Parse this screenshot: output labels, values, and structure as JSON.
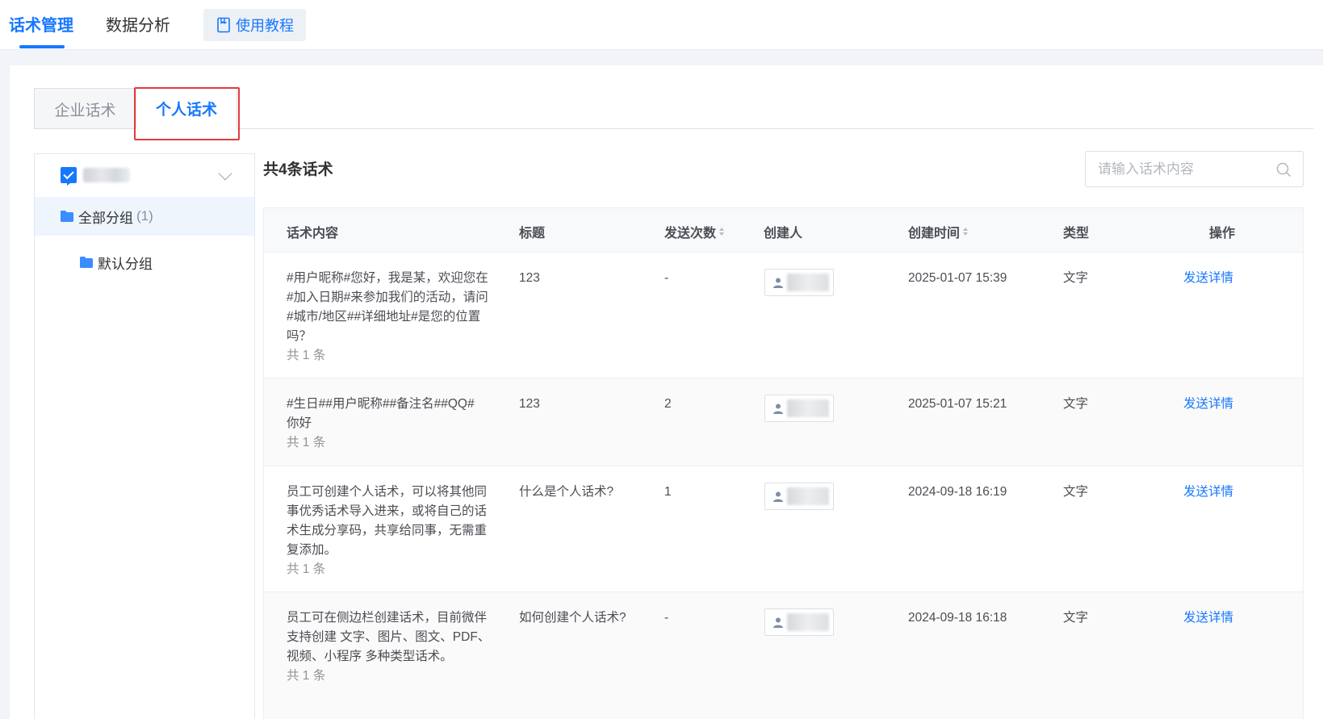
{
  "top_nav": {
    "tabs": [
      {
        "label": "话术管理",
        "active": true
      },
      {
        "label": "数据分析",
        "active": false
      }
    ],
    "tutorial_label": "使用教程"
  },
  "sub_tabs": {
    "enterprise": "企业话术",
    "personal": "个人话术"
  },
  "group_panel": {
    "all_group_label": "全部分组",
    "all_group_count": "(1)",
    "default_group_label": "默认分组"
  },
  "content": {
    "count_title": "共4条话术",
    "search_placeholder": "请输入话术内容"
  },
  "table": {
    "headers": {
      "content": "话术内容",
      "title": "标题",
      "sends": "发送次数",
      "creator": "创建人",
      "time": "创建时间",
      "type": "类型",
      "action": "操作"
    },
    "rows": [
      {
        "content_lines": [
          "#用户昵称#您好，我是某，欢迎您在",
          "#加入日期#来参加我们的活动，请问",
          "#城市/地区##详细地址#是您的位置",
          "吗？"
        ],
        "count": "共 1 条",
        "title": "123",
        "sends": "-",
        "time": "2025-01-07 15:39",
        "type": "文字",
        "action": "发送详情"
      },
      {
        "content_lines": [
          "#生日##用户昵称##备注名##QQ#",
          "你好"
        ],
        "count": "共 1 条",
        "title": "123",
        "sends": "2",
        "time": "2025-01-07 15:21",
        "type": "文字",
        "action": "发送详情"
      },
      {
        "content_lines": [
          "员工可创建个人话术，可以将其他同",
          "事优秀话术导入进来，或将自己的话",
          "术生成分享码，共享给同事，无需重",
          "复添加。"
        ],
        "count": "共 1 条",
        "title": "什么是个人话术?",
        "sends": "1",
        "time": "2024-09-18 16:19",
        "type": "文字",
        "action": "发送详情"
      },
      {
        "content_lines": [
          "员工可在侧边栏创建话术，目前微伴",
          "支持创建 文字、图片、图文、PDF、",
          "视频、小程序 多种类型话术。"
        ],
        "count": "共 1 条",
        "title": "如何创建个人话术?",
        "sends": "-",
        "time": "2024-09-18 16:18",
        "type": "文字",
        "action": "发送详情"
      }
    ]
  },
  "colors": {
    "accent": "#1677ff",
    "highlight": "#e23b3b"
  }
}
